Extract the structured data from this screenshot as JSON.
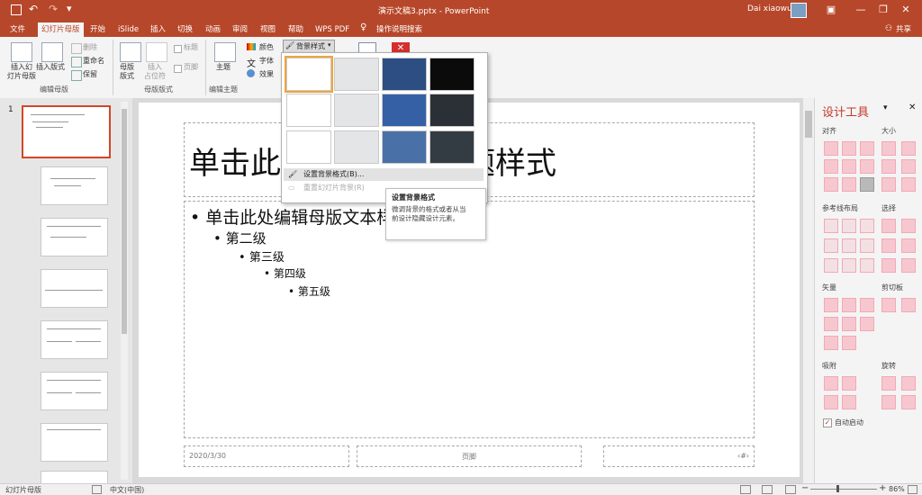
{
  "titlebar": {
    "filename": "演示文稿3.pptx",
    "separator": " - ",
    "app": "PowerPoint",
    "user": "Dai xiaowu",
    "save_icon": "save-icon",
    "undo_icon": "undo-icon",
    "redo_icon": "redo-icon"
  },
  "tabs": [
    "文件",
    "幻灯片母版",
    "开始",
    "iSlide",
    "插入",
    "切换",
    "动画",
    "审阅",
    "视图",
    "帮助",
    "WPS PDF",
    "操作说明搜索"
  ],
  "share_label": "共享",
  "ribbon": {
    "insert_master": "插入幻\n灯片母版",
    "insert_layout": "插入版式",
    "delete": "删除",
    "rename": "重命名",
    "preserve": "保留",
    "group_edit_master": "编辑母版",
    "master_layout": "母版\n版式",
    "insert_placeholder": "插入\n占位符",
    "title_chk": "标题",
    "footer_chk": "页脚",
    "group_master_layout": "母版版式",
    "themes": "主题",
    "colors": "颜色",
    "fonts": "字体",
    "effects": "效果",
    "group_edit_theme": "编辑主题",
    "bg_styles": "背景样式"
  },
  "dropdown": {
    "swatches": [
      "#ffffff",
      "#e4e5e7",
      "#2c4e82",
      "#0b0b0b",
      "#ffffff",
      "#e4e5e7",
      "#3560a6",
      "#2b2f36",
      "#ffffff",
      "#e4e5e7",
      "#4a70a8",
      "#333b43"
    ],
    "menu_format": "设置背景格式(B)...",
    "menu_reset": "重置幻灯片背景(R)"
  },
  "tooltip": {
    "title": "设置背景格式",
    "body": "微调背景的格式或者从当前设计隐藏设计元素。"
  },
  "slide": {
    "title_text": "单击此处编辑母版标题样式",
    "body_levels": [
      "单击此处编辑母版文本样式",
      "第二级",
      "第三级",
      "第四级",
      "第五级"
    ],
    "date": "2020/3/30",
    "footer": "页脚",
    "page_num": "‹#›"
  },
  "left_panel": {
    "slide_number": "1"
  },
  "design_pane": {
    "title": "设计工具",
    "align": "对齐",
    "size": "大小",
    "guides": "参考线布局",
    "select": "选择",
    "vector": "矢量",
    "clip": "剪切板",
    "snap": "吸附",
    "rotate": "旋转",
    "auto_launch": "自动启动"
  },
  "status": {
    "view": "幻灯片母版",
    "language": "中文(中国)",
    "zoom": "86%"
  },
  "colors": {
    "accent": "#b7472a",
    "icon_pink": "#f7c7cf"
  }
}
